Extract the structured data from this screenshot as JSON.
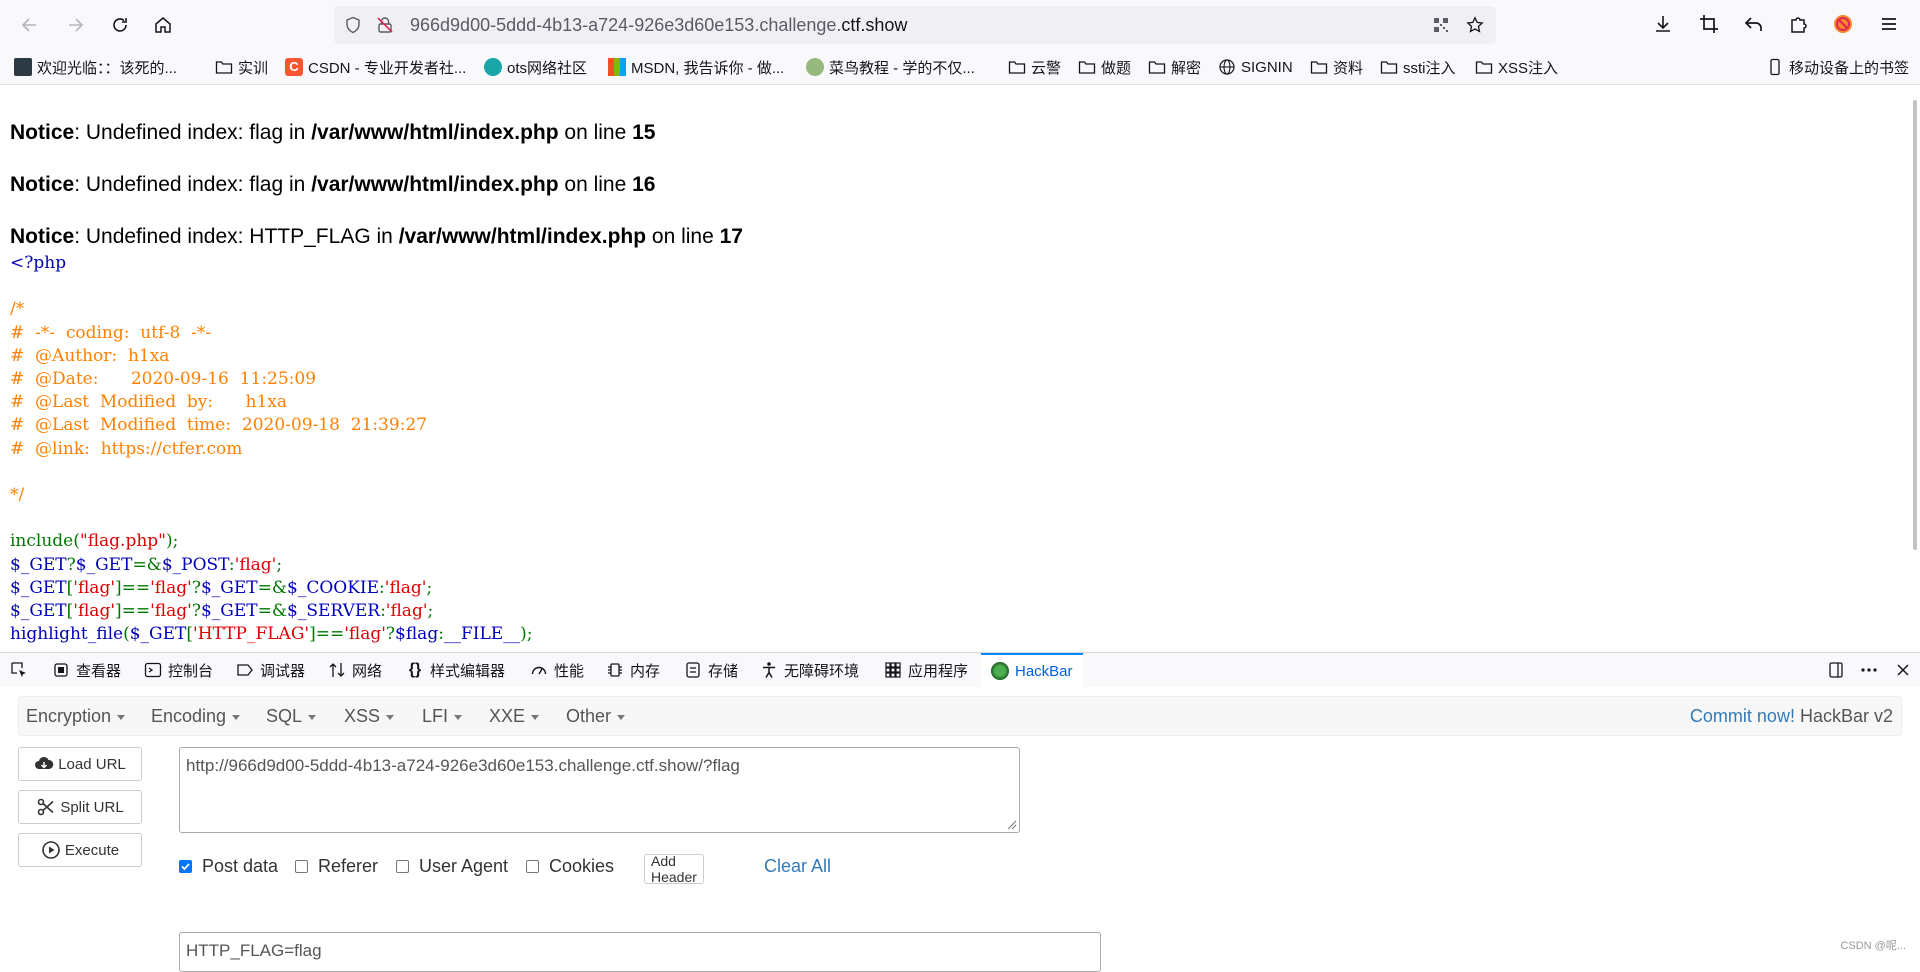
{
  "browser": {
    "url_prefix": "966d9d00-5ddd-4b13-a724-926e3d60e153.challenge.",
    "url_domain": "ctf.show"
  },
  "bookmarks": [
    {
      "label": "欢迎光临：：该死的..."
    },
    {
      "label": "实训"
    },
    {
      "label": "CSDN - 专业开发者社..."
    },
    {
      "label": "ots网络社区"
    },
    {
      "label": "MSDN, 我告诉你 - 做..."
    },
    {
      "label": "菜鸟教程 - 学的不仅..."
    },
    {
      "label": "云警"
    },
    {
      "label": "做题"
    },
    {
      "label": "解密"
    },
    {
      "label": "SIGNIN"
    },
    {
      "label": "资料"
    },
    {
      "label": "ssti注入"
    },
    {
      "label": "XSS注入"
    },
    {
      "label": "移动设备上的书签"
    }
  ],
  "notices": [
    {
      "label": "Notice",
      "msg": ": Undefined index: flag in ",
      "file": "/var/www/html/index.php",
      "on": " on line ",
      "line": "15"
    },
    {
      "label": "Notice",
      "msg": ": Undefined index: flag in ",
      "file": "/var/www/html/index.php",
      "on": " on line ",
      "line": "16"
    },
    {
      "label": "Notice",
      "msg": ": Undefined index: HTTP_FLAG in ",
      "file": "/var/www/html/index.php",
      "on": " on line ",
      "line": "17"
    }
  ],
  "code": {
    "l1": "<?php",
    "l3": "/*",
    "l4": "#  -*-  coding:  utf-8  -*-",
    "l5": "#  @Author:  h1xa",
    "l6": "#  @Date:      2020-09-16  11:25:09",
    "l7": "#  @Last  Modified  by:      h1xa",
    "l8": "#  @Last  Modified  time:  2020-09-18  21:39:27",
    "l9": "#  @link:  https://ctfer.com",
    "l11": "*/",
    "l13a": "include(",
    "l13b": "\"flag.php\"",
    "l13c": ");",
    "l14a": "$_GET",
    "l14b": "?",
    "l14c": "$_GET",
    "l14d": "=&",
    "l14e": "$_POST",
    "l14f": ":",
    "l14g": "'flag'",
    "l14h": ";",
    "l15a": "$_GET",
    "l15b": "[",
    "l15c": "'flag'",
    "l15d": "]==",
    "l15e": "'flag'",
    "l15f": "?",
    "l15g": "$_GET",
    "l15h": "=&",
    "l15i": "$_COOKIE",
    "l15j": ":",
    "l15k": "'flag'",
    "l15l": ";",
    "l16a": "$_GET",
    "l16b": "[",
    "l16c": "'flag'",
    "l16d": "]==",
    "l16e": "'flag'",
    "l16f": "?",
    "l16g": "$_GET",
    "l16h": "=&",
    "l16i": "$_SERVER",
    "l16j": ":",
    "l16k": "'flag'",
    "l16l": ";",
    "l17a": "highlight_file",
    "l17b": "(",
    "l17c": "$_GET",
    "l17d": "[",
    "l17e": "'HTTP_FLAG'",
    "l17f": "]==",
    "l17g": "'flag'",
    "l17h": "?",
    "l17i": "$flag",
    "l17j": ":",
    "l17k": "__FILE__",
    "l17l": ");"
  },
  "devtools": {
    "tabs": [
      "查看器",
      "控制台",
      "调试器",
      "网络",
      "样式编辑器",
      "性能",
      "内存",
      "存储",
      "无障碍环境",
      "应用程序",
      "HackBar"
    ],
    "active_tab": "HackBar"
  },
  "hackbar": {
    "menu": [
      "Encryption",
      "Encoding",
      "SQL",
      "XSS",
      "LFI",
      "XXE",
      "Other"
    ],
    "commit_link": "Commit now!",
    "commit_version": " HackBar v2",
    "load_url": "Load URL",
    "split_url": "Split URL",
    "execute": "Execute",
    "url_value": "http://966d9d00-5ddd-4b13-a724-926e3d60e153.challenge.ctf.show/?flag",
    "checks": [
      {
        "label": "Post data",
        "checked": true
      },
      {
        "label": "Referer",
        "checked": false
      },
      {
        "label": "User Agent",
        "checked": false
      },
      {
        "label": "Cookies",
        "checked": false
      }
    ],
    "add_header": "Add Header",
    "clear_all": "Clear All",
    "post_value": "HTTP_FLAG=flag"
  },
  "watermark": "CSDN @呢..."
}
